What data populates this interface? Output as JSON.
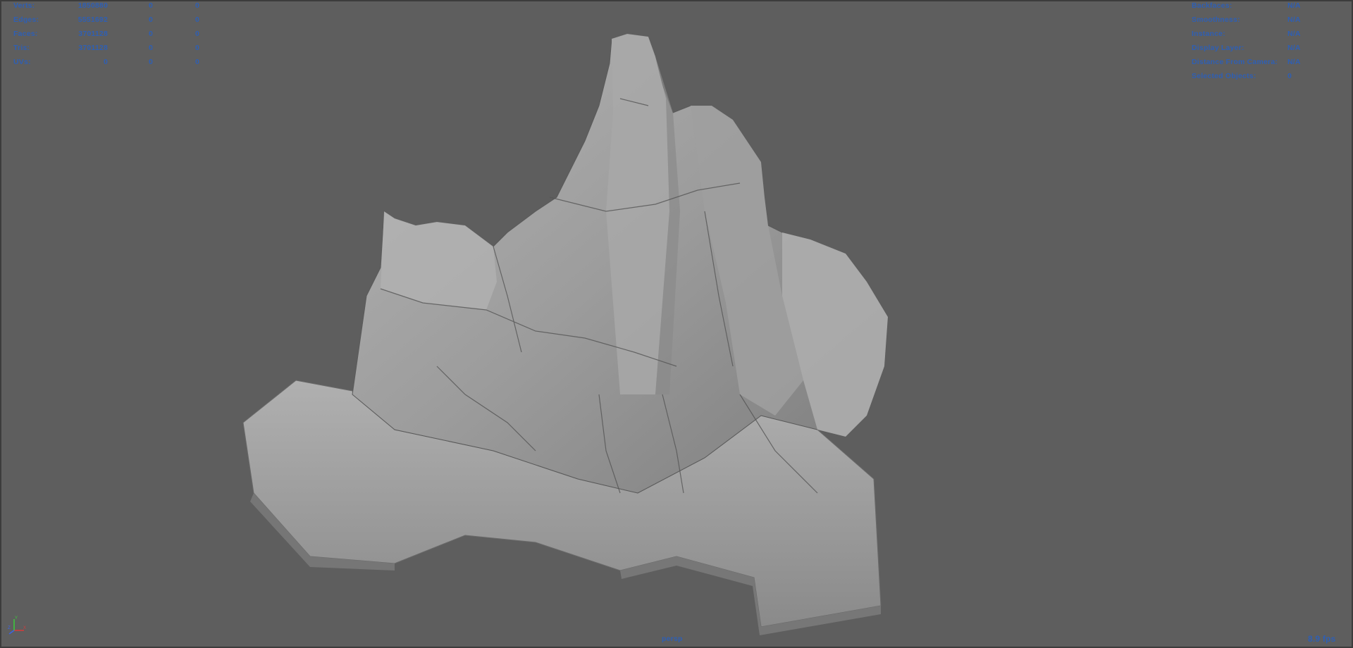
{
  "hud_left": {
    "rows": [
      {
        "label": "Verts:",
        "v1": "1850880",
        "v2": "0",
        "v3": "0"
      },
      {
        "label": "Edges:",
        "v1": "5551692",
        "v2": "0",
        "v3": "0"
      },
      {
        "label": "Faces:",
        "v1": "3701128",
        "v2": "0",
        "v3": "0"
      },
      {
        "label": "Tris:",
        "v1": "3701128",
        "v2": "0",
        "v3": "0"
      },
      {
        "label": "UVs:",
        "v1": "0",
        "v2": "0",
        "v3": "0"
      }
    ]
  },
  "hud_right": {
    "rows": [
      {
        "label": "Backfaces:",
        "value": "N/A"
      },
      {
        "label": "Smoothness:",
        "value": "N/A"
      },
      {
        "label": "Instance:",
        "value": "N/A"
      },
      {
        "label": "Display Layer:",
        "value": "N/A"
      },
      {
        "label": "Distance From Camera:",
        "value": "N/A"
      },
      {
        "label": "Selected Objects:",
        "value": "0"
      }
    ]
  },
  "viewport": {
    "camera": "persp",
    "fps": "8.9 fps"
  },
  "axis_gizmo": {
    "x_axis": "X",
    "y_axis": "Y",
    "z_axis": "Z",
    "x_color": "#d23c3c",
    "y_color": "#3cc83c",
    "z_color": "#3c64e6"
  },
  "colors": {
    "hud_text": "#2f5fb3",
    "background": "#5e5e5e",
    "mesh": "#9a9a9a"
  }
}
